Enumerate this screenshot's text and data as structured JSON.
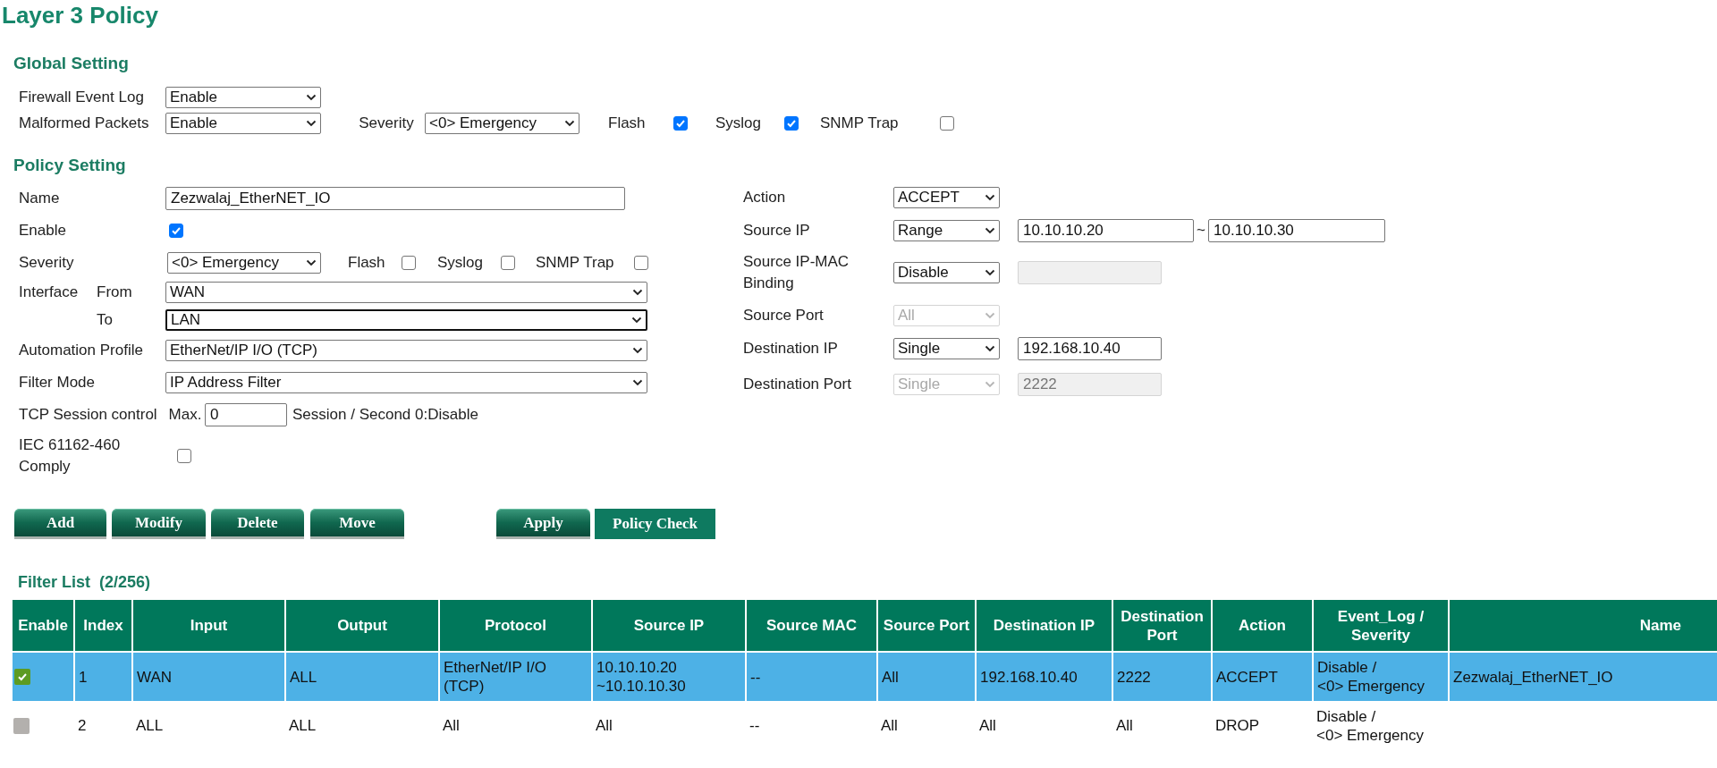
{
  "title": "Layer 3 Policy",
  "global_setting": {
    "heading": "Global Setting",
    "rows": [
      {
        "label": "Firewall Event Log",
        "controls": [
          {
            "kind": "select",
            "value": "Enable",
            "disabled": false
          }
        ]
      },
      {
        "label": "Malformed Packets",
        "controls": [
          {
            "kind": "select",
            "value": "Enable",
            "disabled": false
          },
          {
            "kind": "text",
            "text": "Severity"
          },
          {
            "kind": "select",
            "value": "<0> Emergency",
            "disabled": false
          },
          {
            "kind": "checkbox",
            "label": "Flash",
            "checked": true
          },
          {
            "kind": "checkbox",
            "label": "Syslog",
            "checked": true
          },
          {
            "kind": "checkbox",
            "label": "SNMP Trap",
            "checked": false
          }
        ]
      }
    ]
  },
  "policy_setting": {
    "heading": "Policy Setting",
    "left_rows": [
      {
        "label": "Name",
        "controls": [
          {
            "kind": "input",
            "value": "Zezwalaj_EtherNET_IO",
            "disabled": false
          }
        ]
      },
      {
        "label": "Enable",
        "controls": [
          {
            "kind": "checkbox",
            "checked": true
          }
        ]
      },
      {
        "label": "Severity",
        "controls": [
          {
            "kind": "select",
            "value": "<0> Emergency",
            "disabled": false
          },
          {
            "kind": "checkbox",
            "label": "Flash",
            "checked": false
          },
          {
            "kind": "checkbox",
            "label": "Syslog",
            "checked": false
          },
          {
            "kind": "checkbox",
            "label": "SNMP Trap",
            "checked": false
          }
        ]
      },
      {
        "label": "Interface",
        "sublabel": "From",
        "controls": [
          {
            "kind": "select",
            "value": "WAN",
            "disabled": false
          }
        ]
      },
      {
        "sublabel": "To",
        "controls": [
          {
            "kind": "select",
            "value": "LAN",
            "disabled": false,
            "focused": true
          }
        ]
      },
      {
        "label": "Automation Profile",
        "controls": [
          {
            "kind": "select",
            "value": "EtherNet/IP I/O (TCP)",
            "disabled": false
          }
        ]
      },
      {
        "label": "Filter Mode",
        "controls": [
          {
            "kind": "select",
            "value": "IP Address Filter",
            "disabled": false
          }
        ]
      },
      {
        "label": "TCP Session control",
        "controls": [
          {
            "kind": "text",
            "text": "Max."
          },
          {
            "kind": "input",
            "value": "0",
            "disabled": false
          },
          {
            "kind": "text",
            "text": "Session / Second 0:Disable"
          }
        ]
      },
      {
        "label": "IEC 61162-460\nComply",
        "controls": [
          {
            "kind": "checkbox",
            "checked": false
          }
        ]
      }
    ],
    "right_rows": [
      {
        "label": "Action",
        "controls": [
          {
            "kind": "select",
            "value": "ACCEPT",
            "disabled": false
          }
        ]
      },
      {
        "label": "Source IP",
        "controls": [
          {
            "kind": "select",
            "value": "Range",
            "disabled": false
          },
          {
            "kind": "input",
            "value": "10.10.10.20",
            "disabled": false
          },
          {
            "kind": "text",
            "text": "~"
          },
          {
            "kind": "input",
            "value": "10.10.10.30",
            "disabled": false
          }
        ]
      },
      {
        "label": "Source IP-MAC\nBinding",
        "controls": [
          {
            "kind": "select",
            "value": "Disable",
            "disabled": false
          },
          {
            "kind": "input",
            "disabled": true
          }
        ]
      },
      {
        "label": "Source Port",
        "controls": [
          {
            "kind": "select",
            "value": "All",
            "disabled": true
          }
        ]
      },
      {
        "label": "Destination IP",
        "controls": [
          {
            "kind": "select",
            "value": "Single",
            "disabled": false
          },
          {
            "kind": "input",
            "value": "192.168.10.40",
            "disabled": false
          }
        ]
      },
      {
        "label": "Destination Port",
        "controls": [
          {
            "kind": "select",
            "value": "Single",
            "disabled": true
          },
          {
            "kind": "input",
            "value": "2222",
            "disabled": true
          }
        ]
      }
    ]
  },
  "buttons": [
    {
      "label": "Add",
      "kind": "raised"
    },
    {
      "label": "Modify",
      "kind": "raised"
    },
    {
      "label": "Delete",
      "kind": "raised"
    },
    {
      "label": "Move",
      "kind": "raised"
    },
    {
      "label": "Apply",
      "kind": "raised"
    },
    {
      "label": "Policy Check",
      "kind": "flat"
    }
  ],
  "filter_list": {
    "title": "Filter List",
    "count": "(2/256)",
    "columns": [
      "Enable",
      "Index",
      "Input",
      "Output",
      "Protocol",
      "Source IP",
      "Source MAC",
      "Source Port",
      "Destination IP",
      "Destination\nPort",
      "Action",
      "Event_Log /\nSeverity",
      "Name"
    ],
    "rows": [
      {
        "enabled": true,
        "selected": true,
        "cells": [
          "",
          "1",
          "WAN",
          "ALL",
          "EtherNet/IP I/O\n(TCP)",
          "10.10.10.20\n~10.10.10.30",
          "--",
          "All",
          "192.168.10.40",
          "2222",
          "ACCEPT",
          "Disable /\n<0> Emergency",
          "Zezwalaj_EtherNET_IO"
        ]
      },
      {
        "enabled": false,
        "selected": false,
        "cells": [
          "",
          "2",
          "ALL",
          "ALL",
          "All",
          "All",
          "--",
          "All",
          "All",
          "All",
          "DROP",
          "Disable /\n<0> Emergency"
        ]
      }
    ]
  }
}
